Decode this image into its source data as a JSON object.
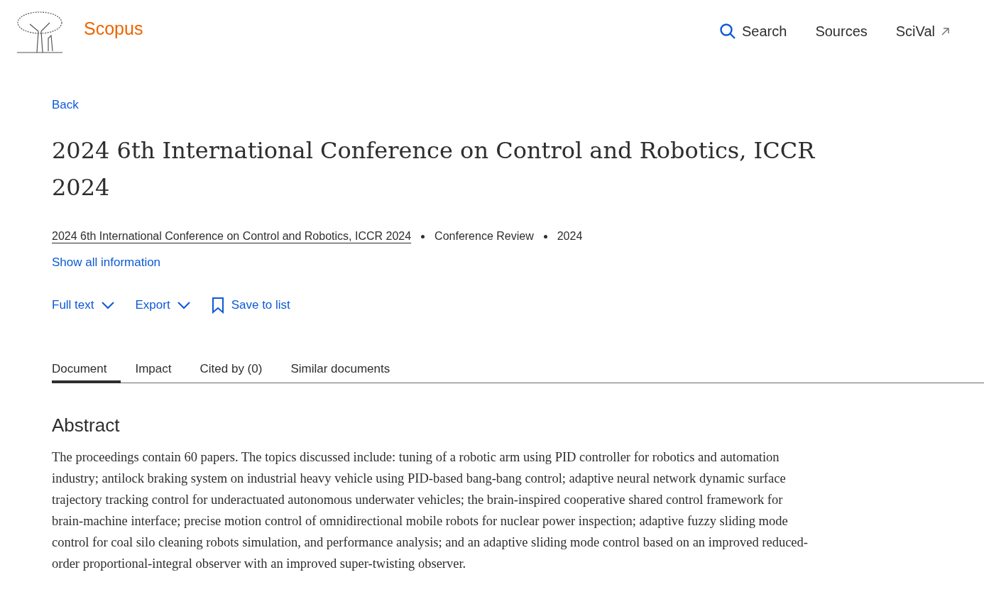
{
  "header": {
    "brand": "Scopus",
    "nav": [
      {
        "label": "Search",
        "kind": "search"
      },
      {
        "label": "Sources",
        "kind": "plain"
      },
      {
        "label": "SciVal",
        "kind": "external"
      }
    ]
  },
  "back": "Back",
  "title": "2024 6th International Conference on Control and Robotics, ICCR 2024",
  "meta": {
    "source": "2024 6th International Conference on Control and Robotics, ICCR 2024",
    "doc_type": "Conference Review",
    "year": "2024"
  },
  "show_all": "Show all information",
  "actions": [
    {
      "label": "Full text",
      "kind": "dropdown"
    },
    {
      "label": "Export",
      "kind": "dropdown"
    },
    {
      "label": "Save to list",
      "kind": "bookmark"
    }
  ],
  "tabs": [
    {
      "label": "Document",
      "selected": true
    },
    {
      "label": "Impact",
      "selected": false
    },
    {
      "label": "Cited by (0)",
      "selected": false
    },
    {
      "label": "Similar documents",
      "selected": false
    }
  ],
  "abstract": {
    "heading": "Abstract",
    "text": "The proceedings contain 60 papers. The topics discussed include: tuning of a robotic arm using PID controller for robotics and automation industry; antilock braking system on industrial heavy vehicle using PID-based bang-bang control; adaptive neural network dynamic surface trajectory tracking control for underactuated autonomous underwater vehicles; the brain-inspired cooperative shared control framework for brain-machine interface; precise motion control of omnidirectional mobile robots for nuclear power inspection; adaptive fuzzy sliding mode control for coal silo cleaning robots simulation, and performance analysis; and an adaptive sliding mode control based on an improved reduced-order proportional-integral observer with an improved super-twisting observer."
  }
}
